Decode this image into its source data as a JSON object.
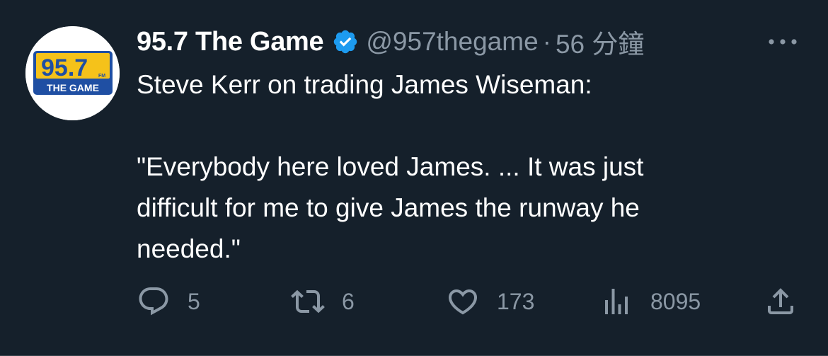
{
  "tweet": {
    "display_name": "95.7 The Game",
    "handle": "@957thegame",
    "separator": "·",
    "time": "56 分鐘",
    "text_lines": [
      "Steve Kerr on trading James Wiseman:",
      "",
      "\"Everybody here loved James. ... It was just",
      "difficult for me to give James the runway he",
      "needed.\""
    ],
    "avatar": {
      "number": "95.7",
      "fm": "FM",
      "station": "THE GAME",
      "colors": {
        "yellow": "#f5c21a",
        "blue": "#1f4fa3"
      }
    }
  },
  "actions": {
    "reply": {
      "icon": "reply-icon",
      "count": "5"
    },
    "retweet": {
      "icon": "retweet-icon",
      "count": "6"
    },
    "like": {
      "icon": "heart-icon",
      "count": "173"
    },
    "views": {
      "icon": "views-chart-icon",
      "count": "8095"
    },
    "share": {
      "icon": "share-icon"
    }
  },
  "colors": {
    "background": "#15202b",
    "text": "#ffffff",
    "muted": "#8b98a5",
    "verified": "#1d9bf0"
  }
}
